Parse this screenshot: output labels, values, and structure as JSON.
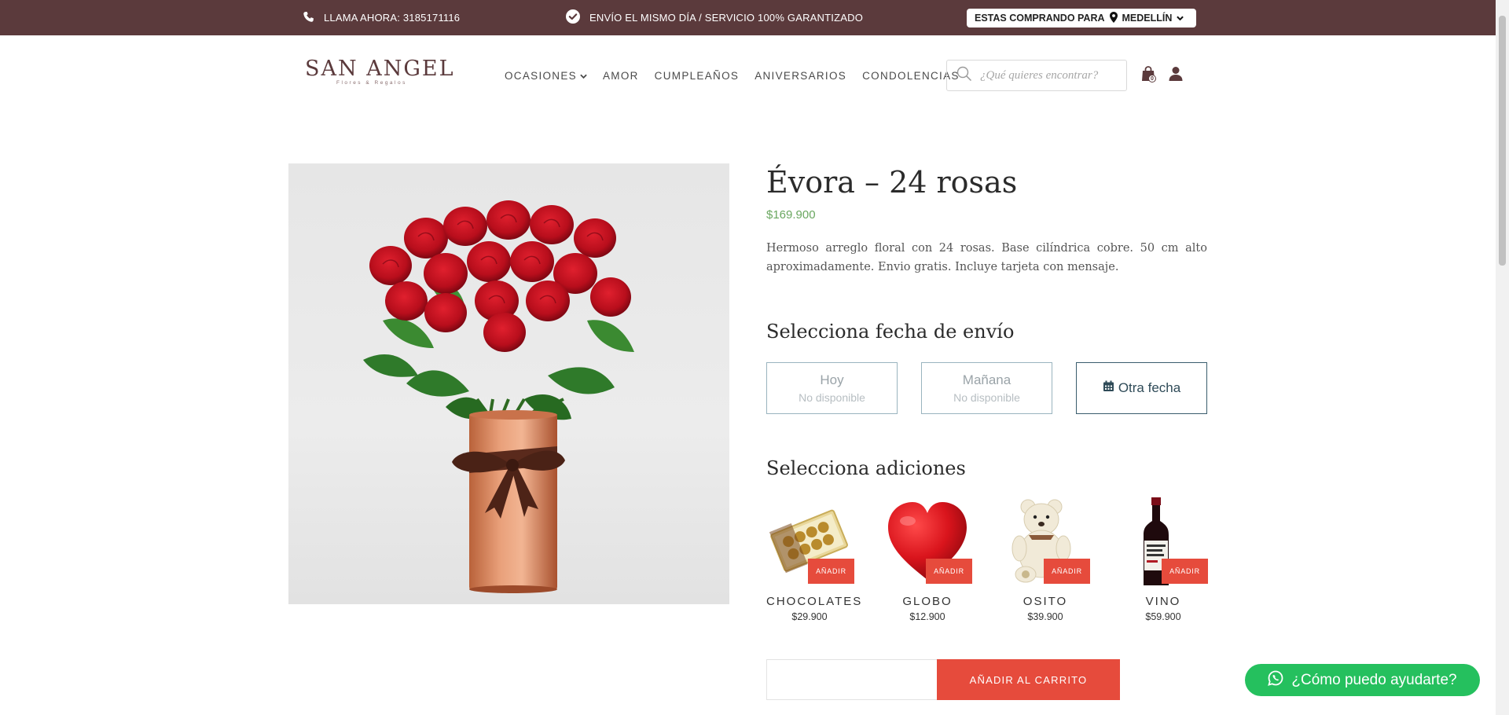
{
  "topbar": {
    "phone": "LLAMA AHORA: 3185171116",
    "shipping": "ENVÍO EL MISMO DÍA / SERVICIO 100% GARANTIZADO",
    "buying_for_label": "ESTAS COMPRANDO PARA",
    "city": "MEDELLÍN",
    "background_color": "#5b3a3c"
  },
  "header": {
    "logo_text": "SAN ANGEL",
    "logo_subtitle": "Flores & Regalos",
    "nav": [
      {
        "label": "OCASIONES",
        "has_dropdown": true
      },
      {
        "label": "AMOR"
      },
      {
        "label": "CUMPLEAÑOS"
      },
      {
        "label": "ANIVERSARIOS"
      },
      {
        "label": "CONDOLENCIAS"
      }
    ],
    "search_placeholder": "¿Qué quieres encontrar?",
    "cart_count": "0",
    "icons": [
      "search-icon",
      "shopping-bag-icon",
      "user-icon"
    ]
  },
  "product": {
    "title": "Évora – 24 rosas",
    "price": "$169.900",
    "price_color": "#6aa760",
    "description": "Hermoso arreglo floral con 24 rosas. Base cilíndrica cobre. 50 cm alto aproximadamente. Envio gratis. Incluye tarjeta con mensaje."
  },
  "delivery": {
    "heading": "Selecciona fecha de envío",
    "options": [
      {
        "label": "Hoy",
        "status": "No disponible"
      },
      {
        "label": "Mañana",
        "status": "No disponible"
      },
      {
        "label": "Otra fecha",
        "icon": "calendar-icon"
      }
    ]
  },
  "addons": {
    "heading": "Selecciona adiciones",
    "button_label": "AÑADIR",
    "items": [
      {
        "name": "CHOCOLATES",
        "price": "$29.900"
      },
      {
        "name": "GLOBO",
        "price": "$12.900"
      },
      {
        "name": "OSITO",
        "price": "$39.900"
      },
      {
        "name": "VINO",
        "price": "$59.900"
      }
    ]
  },
  "cart": {
    "button_label": "AÑADIR AL CARRITO",
    "accent_color": "#e64b3c"
  },
  "chat": {
    "label": "¿Cómo puedo ayudarte?",
    "color": "#25c05e"
  }
}
